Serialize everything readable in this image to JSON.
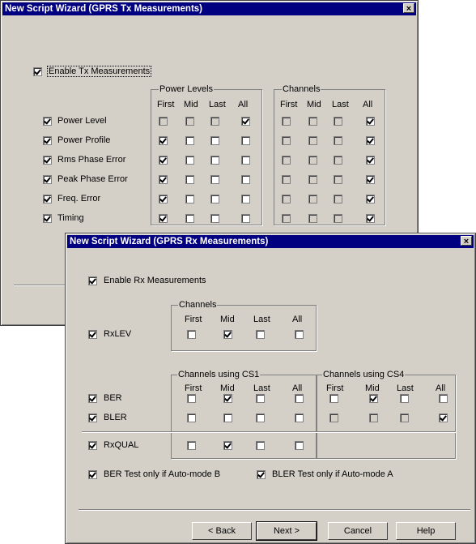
{
  "tx": {
    "title": "New Script Wizard (GPRS Tx Measurements)",
    "close": "×",
    "enable_label": "Enable Tx Measurements",
    "enable_checked": true,
    "power_levels_title": "Power Levels",
    "channels_title": "Channels",
    "col_headers": [
      "First",
      "Mid",
      "Last",
      "All"
    ],
    "rows": [
      {
        "label": "Power Level",
        "checked": true,
        "power": [
          false,
          false,
          false,
          true
        ],
        "channels": [
          false,
          false,
          false,
          true
        ],
        "power_disabled": [
          true,
          true,
          true,
          false
        ]
      },
      {
        "label": "Power Profile",
        "checked": true,
        "power": [
          true,
          false,
          false,
          false
        ],
        "channels": [
          false,
          false,
          false,
          true
        ],
        "power_disabled": [
          false,
          false,
          false,
          false
        ]
      },
      {
        "label": "Rms Phase Error",
        "checked": true,
        "power": [
          true,
          false,
          false,
          false
        ],
        "channels": [
          false,
          false,
          false,
          true
        ],
        "power_disabled": [
          false,
          false,
          false,
          false
        ]
      },
      {
        "label": "Peak Phase Error",
        "checked": true,
        "power": [
          true,
          false,
          false,
          false
        ],
        "channels": [
          false,
          false,
          false,
          true
        ],
        "power_disabled": [
          false,
          false,
          false,
          false
        ]
      },
      {
        "label": "Freq. Error",
        "checked": true,
        "power": [
          true,
          false,
          false,
          false
        ],
        "channels": [
          false,
          false,
          false,
          true
        ],
        "power_disabled": [
          false,
          false,
          false,
          false
        ]
      },
      {
        "label": "Timing",
        "checked": true,
        "power": [
          true,
          false,
          false,
          false
        ],
        "channels": [
          false,
          false,
          false,
          true
        ],
        "power_disabled": [
          false,
          false,
          false,
          false
        ]
      }
    ]
  },
  "rx": {
    "title": "New Script Wizard (GPRS Rx Measurements)",
    "close": "×",
    "enable_label": "Enable Rx Measurements",
    "enable_checked": true,
    "channels_title": "Channels",
    "cs1_title": "Channels using CS1",
    "cs4_title": "Channels using CS4",
    "col_headers": [
      "First",
      "Mid",
      "Last",
      "All"
    ],
    "rxlev": {
      "label": "RxLEV",
      "checked": true,
      "channels": [
        false,
        true,
        false,
        false
      ]
    },
    "ber": {
      "label": "BER",
      "checked": true,
      "cs1": [
        false,
        true,
        false,
        false
      ],
      "cs4": [
        false,
        true,
        false,
        false
      ]
    },
    "bler": {
      "label": "BLER",
      "checked": true,
      "cs1": [
        false,
        false,
        false,
        false
      ],
      "cs4": [
        false,
        false,
        false,
        true
      ]
    },
    "rxqual": {
      "label": "RxQUAL",
      "checked": true,
      "cs1": [
        false,
        true,
        false,
        false
      ]
    },
    "ber_auto_label": "BER Test only if Auto-mode B",
    "ber_auto_checked": true,
    "bler_auto_label": "BLER Test only if Auto-mode A",
    "bler_auto_checked": true,
    "buttons": {
      "back": "< Back",
      "next": "Next >",
      "cancel": "Cancel",
      "help": "Help"
    }
  }
}
